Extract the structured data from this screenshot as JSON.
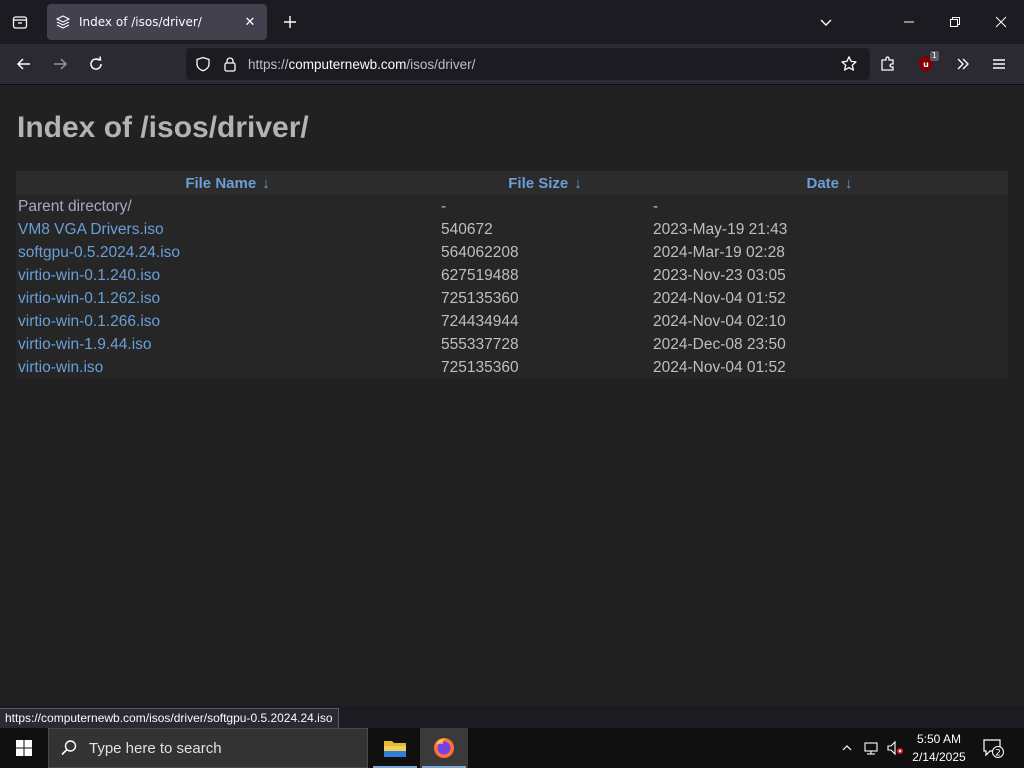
{
  "browser": {
    "tab": {
      "title": "Index of /isos/driver/",
      "favicon": "server-icon"
    },
    "url": {
      "scheme": "https://",
      "host": "computernewb.com",
      "path": "/isos/driver/"
    },
    "extension_badge": "1"
  },
  "page": {
    "title": "Index of /isos/driver/",
    "columns": {
      "name": "File Name",
      "size": "File Size",
      "date": "Date",
      "sort_arrow": "↓"
    },
    "rows": [
      {
        "name": "Parent directory/",
        "size": "-",
        "date": "-"
      },
      {
        "name": "VM8 VGA Drivers.iso",
        "size": "540672",
        "date": "2023-May-19 21:43"
      },
      {
        "name": "softgpu-0.5.2024.24.iso",
        "size": "564062208",
        "date": "2024-Mar-19 02:28"
      },
      {
        "name": "virtio-win-0.1.240.iso",
        "size": "627519488",
        "date": "2023-Nov-23 03:05"
      },
      {
        "name": "virtio-win-0.1.262.iso",
        "size": "725135360",
        "date": "2024-Nov-04 01:52"
      },
      {
        "name": "virtio-win-0.1.266.iso",
        "size": "724434944",
        "date": "2024-Nov-04 02:10"
      },
      {
        "name": "virtio-win-1.9.44.iso",
        "size": "555337728",
        "date": "2024-Dec-08 23:50"
      },
      {
        "name": "virtio-win.iso",
        "size": "725135360",
        "date": "2024-Nov-04 01:52"
      }
    ]
  },
  "status_bar": {
    "text": "https://computernewb.com/isos/driver/softgpu-0.5.2024.24.iso"
  },
  "taskbar": {
    "search_placeholder": "Type here to search",
    "time": "5:50 AM",
    "date": "2/14/2025",
    "notification_count": "2"
  },
  "colors": {
    "link": "#6a9fd8",
    "background": "#212121",
    "title": "#b3b3b3"
  }
}
